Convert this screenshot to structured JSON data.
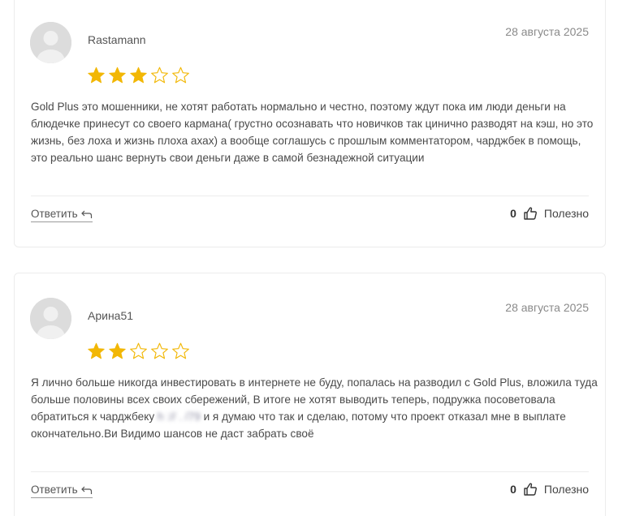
{
  "reviews": [
    {
      "author": "Rastamann",
      "date": "28 августа 2025",
      "rating": 3,
      "max_rating": 5,
      "text": "Gold Plus это мошенники, не хотят работать нормально и честно, поэтому ждут пока им люди деньги на блюдечке принесут со своего кармана( грустно осознавать что новичков так цинично разводят на кэш, но это жизнь, без лоха и жизнь плоха ахах) а вообще соглашусь с прошлым комментатором, чарджбек в помощь, это реально шанс вернуть свои деньги даже в самой безнадежной ситуации",
      "reply_label": "Ответить",
      "helpful_count": "0",
      "helpful_label": "Полезно"
    },
    {
      "author": "Арина51",
      "date": "28 августа 2025",
      "rating": 2,
      "max_rating": 5,
      "text_before": "Я лично больше никогда инвестировать в интернете не буду, попалась на разводил с Gold Plus, вложила туда больше половины всех своих сбережений, В итоге не хотят выводить теперь, подружка посоветовала обратиться к чарджбеку ",
      "text_blurred": "h    ://        .    /79            ",
      "text_after": "и я думаю что так и сделаю, потому что проект отказал мне в выплате окончательно.Ви Видимо шансов не даст забрать своё",
      "reply_label": "Ответить",
      "helpful_count": "0",
      "helpful_label": "Полезно"
    }
  ],
  "colors": {
    "star": "#f2b705",
    "border": "#ececec",
    "text": "#4a4a4a",
    "date": "#8a8a8a"
  },
  "icons": {
    "avatar": "user-avatar-icon",
    "star_filled": "star-filled-icon",
    "star_empty": "star-outline-icon",
    "reply": "reply-arrow-icon",
    "thumb": "thumbs-up-icon"
  }
}
